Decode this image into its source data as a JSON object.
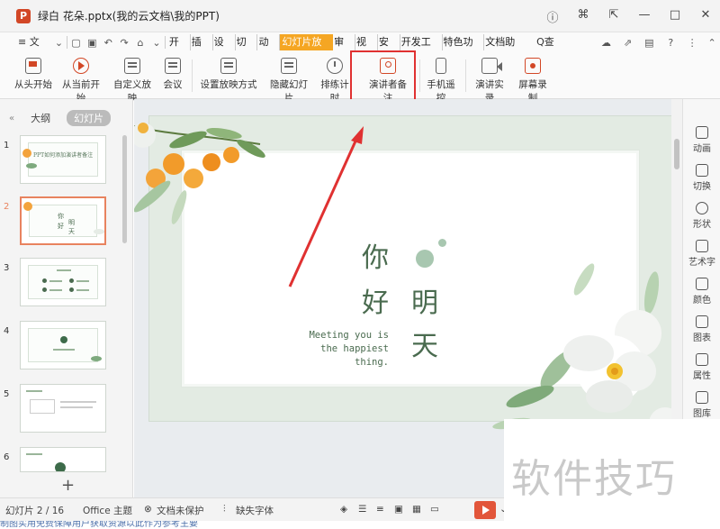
{
  "titlebar": {
    "app_icon": "P",
    "title": "绿白 花朵.pptx(我的云文档\\我的PPT)",
    "controls": [
      "ⓘ",
      "⌘",
      "⇱",
      "—",
      "□",
      "✕"
    ]
  },
  "menubar": {
    "menu": "≡ 文件",
    "tabs": [
      "开始",
      "插入",
      "设计",
      "切换",
      "动画",
      "幻灯片放映",
      "审阅",
      "视图",
      "安全",
      "开发工具",
      "特色功能",
      "文档助手"
    ],
    "active_tab": "幻灯片放映",
    "search": "Q查找",
    "accent": "#f5a623"
  },
  "ribbon": {
    "buttons": [
      "从头开始",
      "从当前开始",
      "自定义放映",
      "会议",
      "设置放映方式",
      "隐藏幻灯片",
      "排练计时",
      "演讲者备注",
      "手机遥控",
      "演讲实录",
      "屏幕录制"
    ],
    "highlighted": "演讲者备注",
    "highlight_color": "#e03131"
  },
  "leftpanel": {
    "tabs": [
      "大纲",
      "幻灯片"
    ],
    "active_tab": "幻灯片",
    "slides": [
      "1",
      "2",
      "3",
      "4",
      "5",
      "6"
    ],
    "selected_slide": "2",
    "slide1_title": "PPT如何添加演讲者备注",
    "add": "+"
  },
  "slide": {
    "chars": [
      "你",
      "好",
      "明",
      "天"
    ],
    "english": [
      "Meeting you is",
      "the happiest",
      "thing."
    ]
  },
  "rightbar": {
    "items": [
      "动画",
      "切换",
      "形状",
      "艺术字",
      "颜色",
      "图表",
      "属性",
      "图库"
    ]
  },
  "statusbar": {
    "slide_count": "幻灯片 2 / 16",
    "theme": "Office 主题",
    "protect": "文档未保护",
    "font_missing": "缺失字体"
  },
  "bottom_cut_text": "制图实用免费保障用户获取资源以此作为参考主要",
  "watermark": "软件技巧"
}
